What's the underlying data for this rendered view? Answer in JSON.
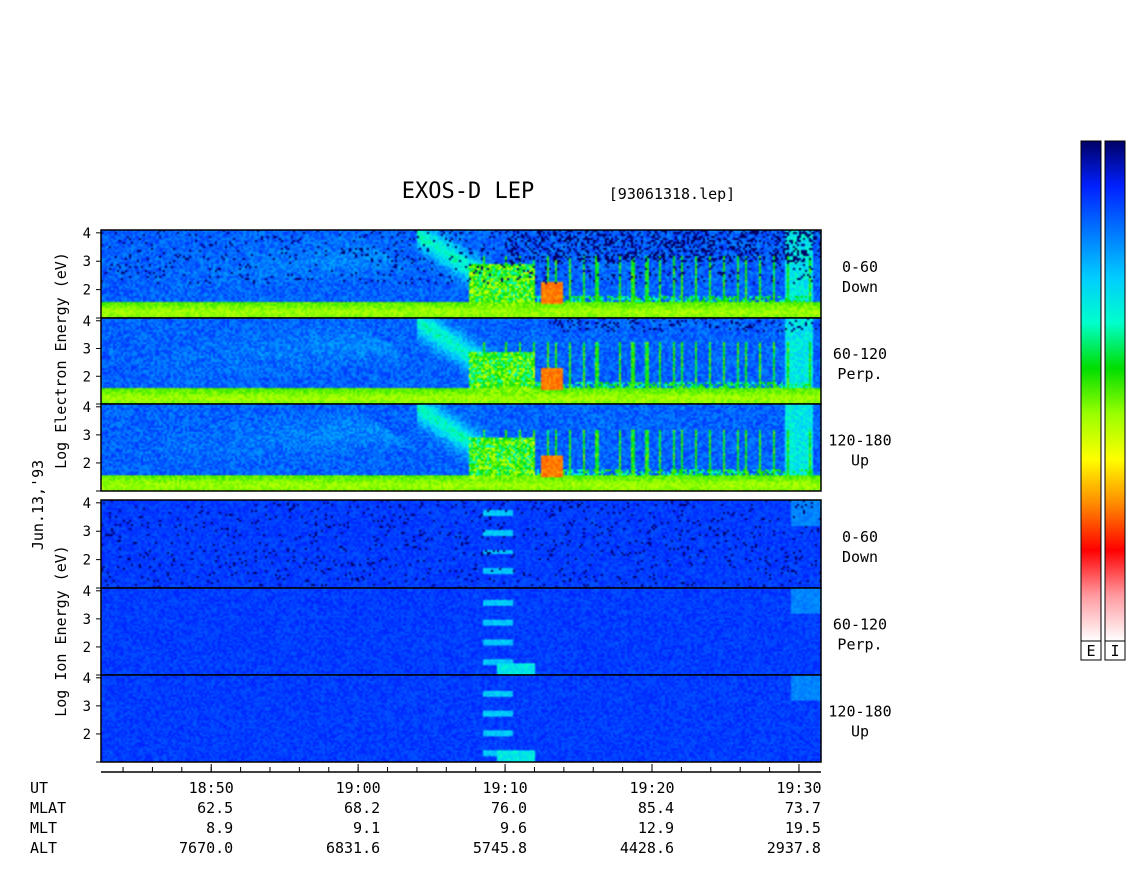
{
  "chart_data": {
    "type": "heatmap",
    "title": "EXOS-D LEP",
    "subtitle": "[93061318.lep]",
    "date_label": "Jun.13,'93",
    "groups": [
      {
        "ylabel_words": [
          "Log",
          "Electron",
          "Energy",
          "(eV)"
        ],
        "panels": [
          {
            "angle": "0-60",
            "direction": "Down"
          },
          {
            "angle": "60-120",
            "direction": "Perp."
          },
          {
            "angle": "120-180",
            "direction": "Up"
          }
        ]
      },
      {
        "ylabel_words": [
          "Log",
          "Ion",
          "Energy",
          "(eV)"
        ],
        "panels": [
          {
            "angle": "0-60",
            "direction": "Down"
          },
          {
            "angle": "60-120",
            "direction": "Perp."
          },
          {
            "angle": "120-180",
            "direction": "Up"
          }
        ]
      }
    ],
    "y_ticks": [
      "1",
      "2",
      "3",
      "4"
    ],
    "ylim": [
      1,
      4.1
    ],
    "x_time_range_min": [
      -2.5,
      46.5
    ],
    "x_tick_labels": [
      {
        "min": 5,
        "label": "18:50"
      },
      {
        "min": 15,
        "label": "19:00"
      },
      {
        "min": 25,
        "label": "19:10"
      },
      {
        "min": 35,
        "label": "19:20"
      },
      {
        "min": 45,
        "label": "19:30"
      }
    ],
    "orbit": {
      "labels": [
        "UT",
        "MLAT",
        "MLT",
        "ALT"
      ],
      "MLAT": [
        "62.5",
        "68.2",
        "76.0",
        "85.4",
        "73.7"
      ],
      "MLT": [
        "8.9",
        "9.1",
        "9.6",
        "12.9",
        "19.5"
      ],
      "ALT": [
        "7670.0",
        "6831.6",
        "5745.8",
        "4428.6",
        "2937.8"
      ]
    },
    "colorbar_labels": [
      "E",
      "I"
    ],
    "colormap": [
      "#ffffff",
      "#ff9aa0",
      "#ff0000",
      "#ff8800",
      "#ffff00",
      "#99ff00",
      "#00dd00",
      "#00ffcc",
      "#00ccff",
      "#0077ff",
      "#0020ff",
      "#000066"
    ]
  }
}
